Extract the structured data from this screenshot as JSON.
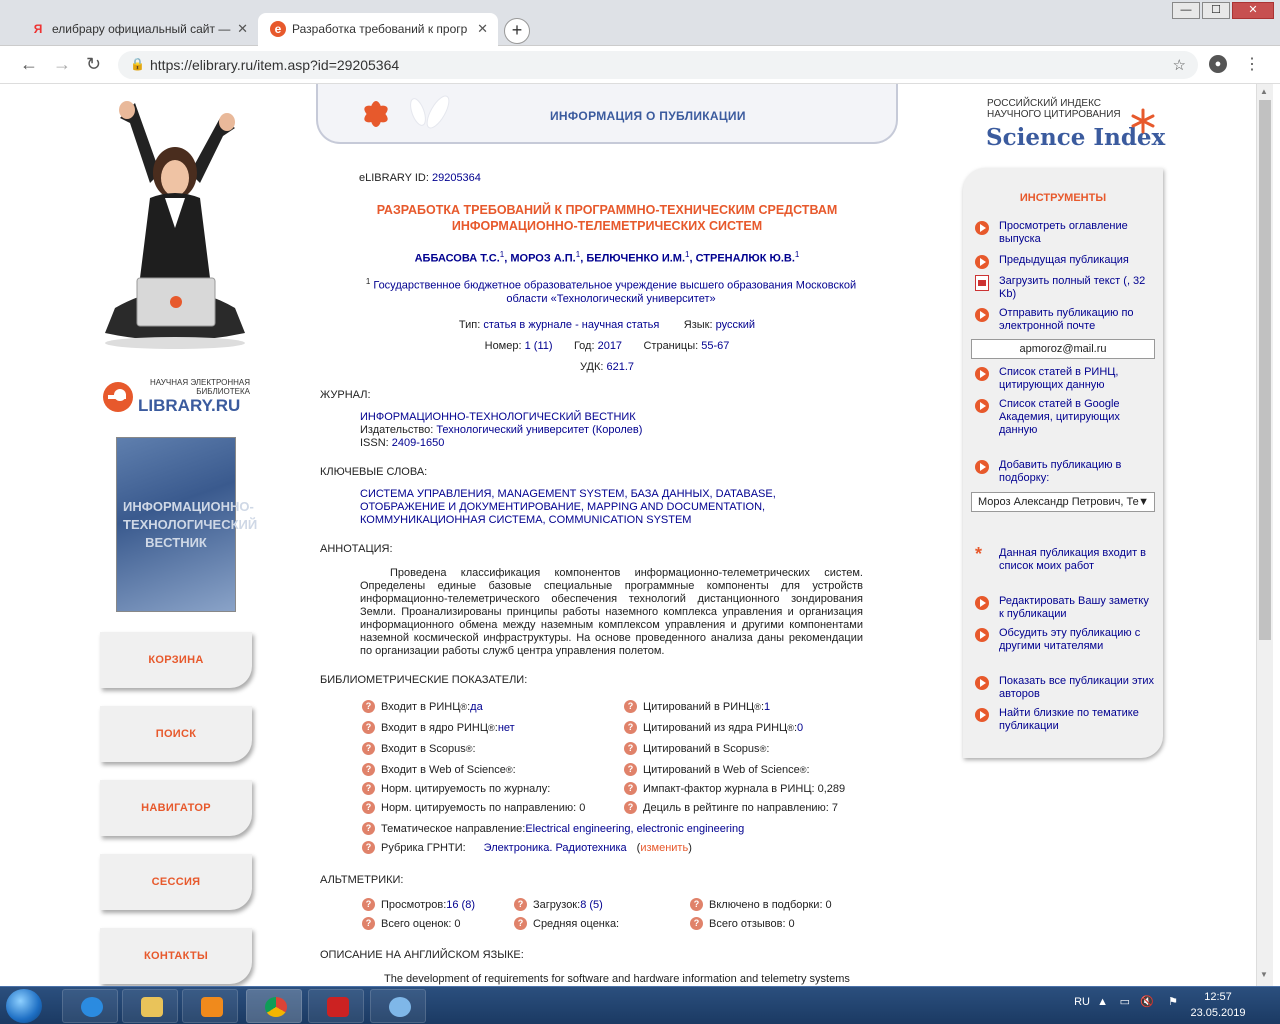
{
  "browser": {
    "tabs": [
      {
        "label": "елибрару официальный сайт —",
        "icon": "yandex-icon",
        "active": false
      },
      {
        "label": "Разработка требований к прогр",
        "icon": "elibrary-icon",
        "active": true
      }
    ],
    "url": "https://elibrary.ru/item.asp?id=29205364"
  },
  "left": {
    "logo_caption": "НАУЧНАЯ ЭЛЕКТРОННАЯ БИБЛИОТЕКА",
    "logo_name": "LIBRARY.RU",
    "cover_text": "ИНФОРМАЦИОННО-ТЕХНОЛОГИЧЕСКИЙ ВЕСТНИК",
    "buttons": [
      "КОРЗИНА",
      "ПОИСК",
      "НАВИГАТОР",
      "СЕССИЯ",
      "КОНТАКТЫ"
    ]
  },
  "header": {
    "title": "ИНФОРМАЦИЯ О ПУБЛИКАЦИИ"
  },
  "pub": {
    "elib_id_label": "eLIBRARY ID: ",
    "elib_id": "29205364",
    "title": "РАЗРАБОТКА ТРЕБОВАНИЙ К ПРОГРАММНО-ТЕХНИЧЕСКИМ СРЕДСТВАМ ИНФОРМАЦИОННО-ТЕЛЕМЕТРИЧЕСКИХ СИСТЕМ",
    "authors": [
      "АББАСОВА Т.С.",
      "МОРОЗ А.П.",
      "БЕЛЮЧЕНКО И.М.",
      "СТРЕНАЛЮК Ю.В."
    ],
    "affil_sup": "1",
    "affiliation": "Государственное бюджетное образовательное учреждение высшего образования Московской области «Технологический университет»",
    "type_label": "Тип: ",
    "type": "статья в журнале - научная статья",
    "lang_label": "Язык: ",
    "lang": "русский",
    "issue_label": "Номер: ",
    "issue": "1 (11)",
    "year_label": "Год: ",
    "year": "2017",
    "pages_label": "Страницы: ",
    "pages": "55-67",
    "udk_label": "УДК: ",
    "udk": "621.7"
  },
  "journal": {
    "heading": "ЖУРНАЛ:",
    "name": "ИНФОРМАЦИОННО-ТЕХНОЛОГИЧЕСКИЙ ВЕСТНИК",
    "publisher_label": "Издательство: ",
    "publisher": "Технологический университет (Королев)",
    "issn_label": "ISSN: ",
    "issn": "2409-1650"
  },
  "keywords": {
    "heading": "КЛЮЧЕВЫЕ СЛОВА:",
    "text": "СИСТЕМА УПРАВЛЕНИЯ, MANAGEMENT SYSTEM, БАЗА ДАННЫХ, DATABASE, ОТОБРАЖЕНИЕ И ДОКУМЕНТИРОВАНИЕ, MAPPING AND DOCUMENTATION, КОММУНИКАЦИОННАЯ СИСТЕМА, COMMUNICATION SYSTEM"
  },
  "abstract": {
    "heading": "АННОТАЦИЯ:",
    "text": "Проведена классификация компонентов информационно-телеметрических систем. Определены единые базовые специальные программные компоненты для устройств информационно-телеметрического обеспечения технологий дистанционного зондирования Земли. Проанализированы принципы работы наземного комплекса управления и организация информационного обмена между наземным комплексом управления и другими компонентами наземной космической инфраструктуры. На основе проведенного анализа даны рекомендации по организации работы служб центра управления полетом."
  },
  "biblio": {
    "heading": "БИБЛИОМЕТРИЧЕСКИЕ ПОКАЗАТЕЛИ:",
    "left": [
      {
        "label": "Входит в РИНЦ",
        "sup": "®",
        "sep": ": ",
        "value": "да"
      },
      {
        "label": "Входит в ядро РИНЦ",
        "sup": "®",
        "sep": ": ",
        "value": "нет"
      },
      {
        "label": "Входит в Scopus",
        "sup": "®",
        "sep": ":",
        "value": ""
      },
      {
        "label": "Входит в Web of Science",
        "sup": "®",
        "sep": ":",
        "value": ""
      },
      {
        "label": "Норм. цитируемость по журналу:",
        "sup": "",
        "sep": "",
        "value": ""
      },
      {
        "label": "Норм. цитируемость по направлению: 0",
        "sup": "",
        "sep": "",
        "value": ""
      }
    ],
    "right": [
      {
        "label": "Цитирований в РИНЦ",
        "sup": "®",
        "sep": ": ",
        "value": "1"
      },
      {
        "label": "Цитирований из ядра РИНЦ",
        "sup": "®",
        "sep": ": ",
        "value": "0"
      },
      {
        "label": "Цитирований в Scopus",
        "sup": "®",
        "sep": ":",
        "value": ""
      },
      {
        "label": "Цитирований в Web of Science",
        "sup": "®",
        "sep": ":",
        "value": ""
      },
      {
        "label": "Импакт-фактор журнала в РИНЦ: 0,289",
        "sup": "",
        "sep": "",
        "value": ""
      },
      {
        "label": "Дециль в рейтинге по направлению: 7",
        "sup": "",
        "sep": "",
        "value": ""
      }
    ],
    "theme_label": "Тематическое направление: ",
    "theme": "Electrical engineering, electronic engineering",
    "grnti_label": "Рубрика ГРНТИ:",
    "grnti": "Электроника. Радиотехника",
    "grnti_change": "изменить"
  },
  "altmetrics": {
    "heading": "АЛЬТМЕТРИКИ:",
    "views_label": "Просмотров: ",
    "views": "16 (8)",
    "downloads_label": "Загрузок: ",
    "downloads": "8 (5)",
    "collections": "Включено в подборки: 0",
    "ratings": "Всего оценок: 0",
    "avg_rating": "Средняя оценка:",
    "reviews": "Всего отзывов: 0"
  },
  "english": {
    "heading": "ОПИСАНИЕ НА АНГЛИЙСКОМ ЯЗЫКЕ:",
    "text": "The development of requirements for software and hardware information and telemetry systems"
  },
  "rinc": {
    "line1": "РОССИЙСКИЙ ИНДЕКС",
    "line2": "НАУЧНОГО ЦИТИРОВАНИЯ",
    "brand": "Science Index"
  },
  "tools": {
    "heading": "ИНСТРУМЕНТЫ",
    "items": [
      "Просмотреть оглавление выпуска",
      "Предыдущая публикация",
      "Загрузить полный текст (, 32 Kb)",
      "Отправить публикацию по электронной почте",
      "Список статей в РИНЦ, цитирующих данную",
      "Список статей в Google Академия, цитирующих данную",
      "Добавить публикацию в подборку:",
      "Данная публикация входит в список моих работ",
      "Редактировать Вашу заметку к публикации",
      "Обсудить эту публикацию с другими читателями",
      "Показать все публикации этих авторов",
      "Найти близкие по тематике публикации"
    ],
    "email": "apmoroz@mail.ru",
    "collection_select": "Мороз Александр Петрович, Те"
  },
  "taskbar": {
    "lang": "RU",
    "time": "12:57",
    "date": "23.05.2019"
  }
}
